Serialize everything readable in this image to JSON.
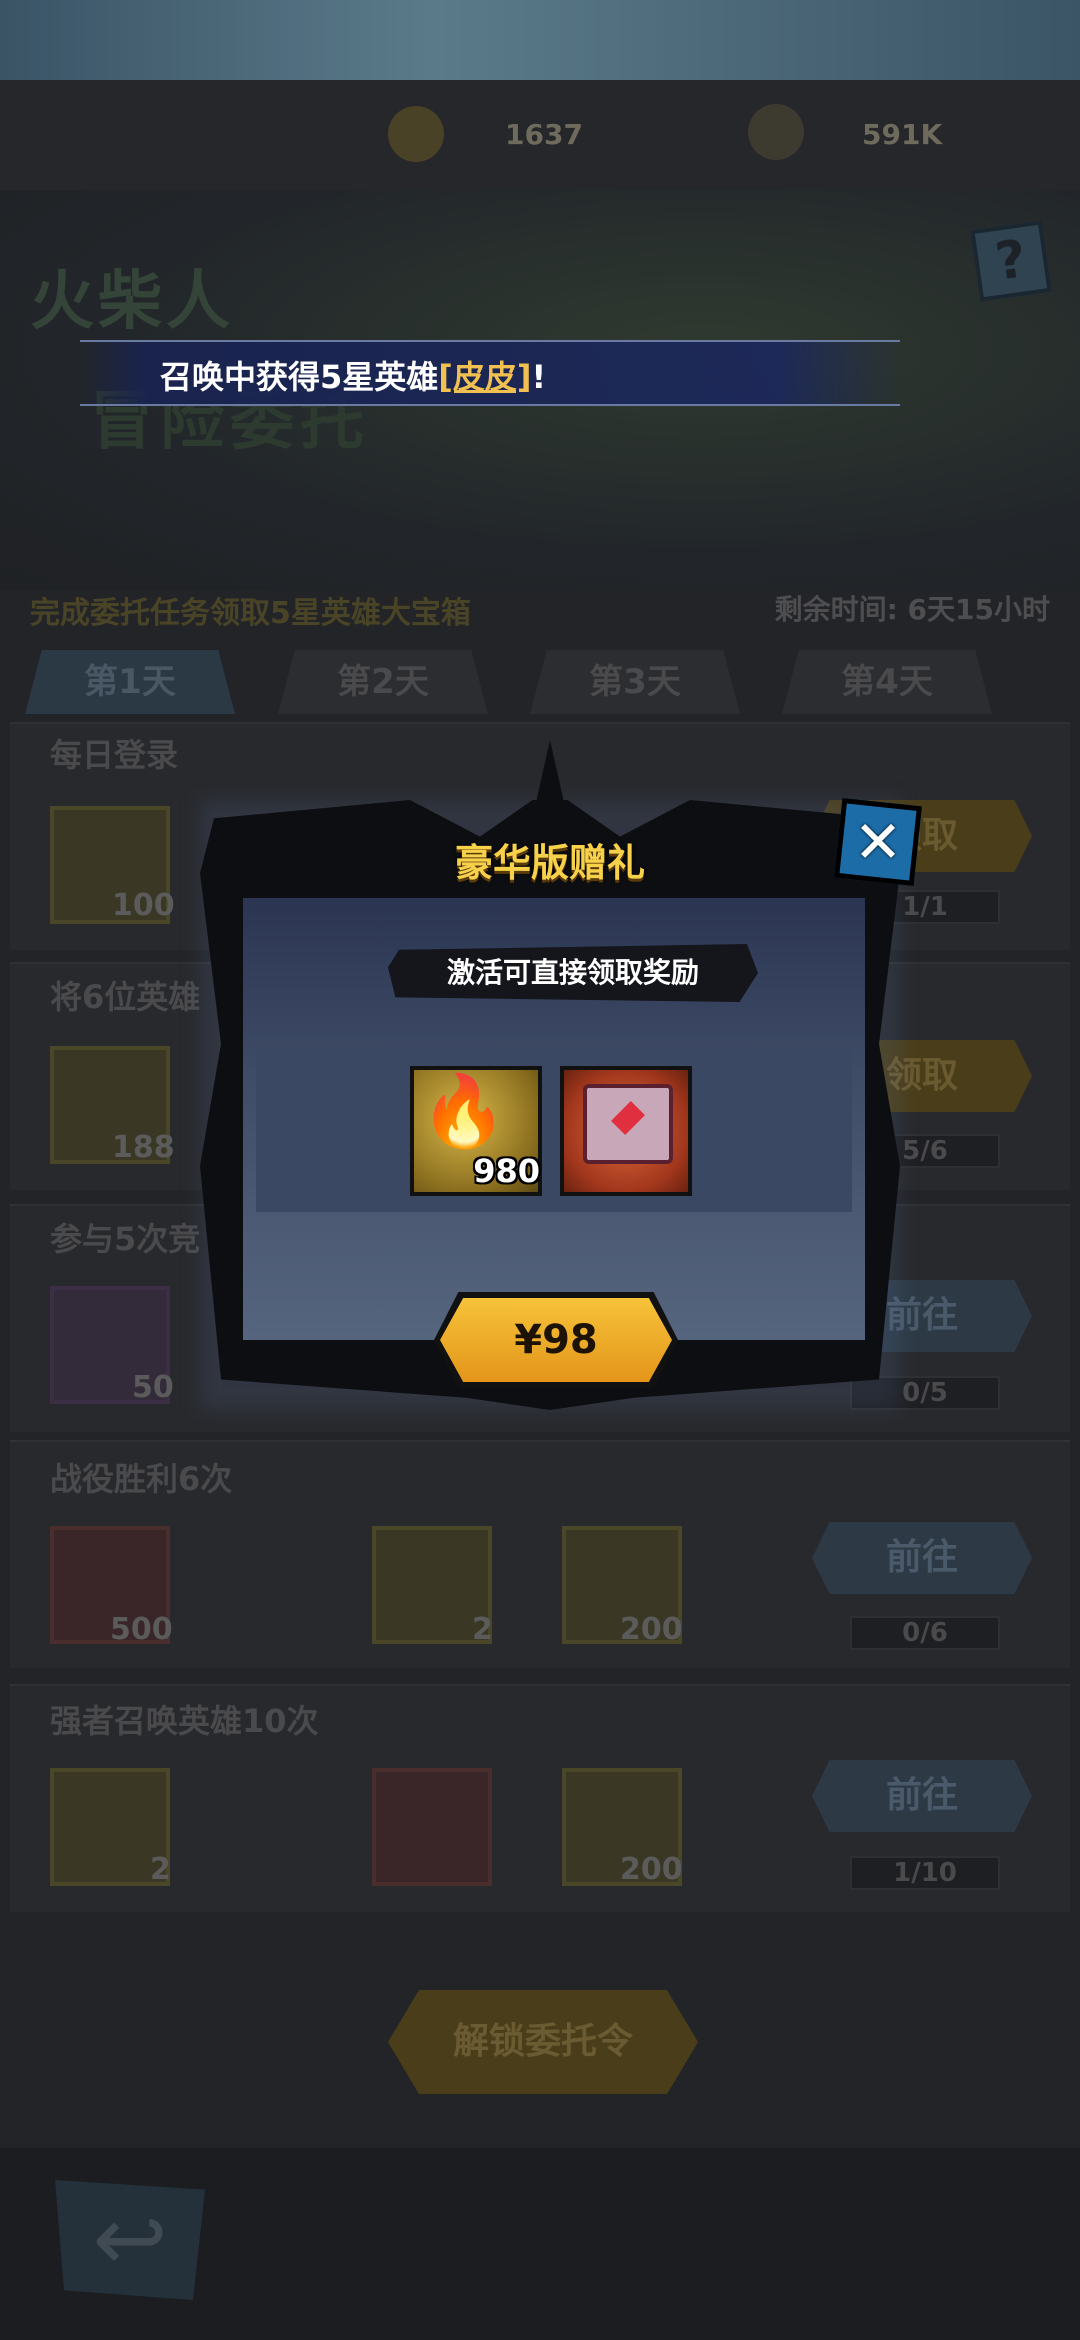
{
  "resources": {
    "torch_value": "1637",
    "coin_value": "591K"
  },
  "banner": {
    "title_line1": "火柴人",
    "title_line2": "冒险委托",
    "help_label": "?"
  },
  "notice": {
    "prefix": "召唤中获得5星英雄",
    "hero": "[皮皮]",
    "suffix": "!"
  },
  "event": {
    "subtitle": "完成委托任务领取5星英雄大宝箱",
    "remaining": "剩余时间: 6天15小时"
  },
  "tabs": [
    "第1天",
    "第2天",
    "第3天",
    "第4天"
  ],
  "tasks": [
    {
      "title": "每日登录",
      "reward_count": "100",
      "button": "领取",
      "progress": "1/1"
    },
    {
      "title": "将6位英雄",
      "reward_count": "188",
      "button": "领取",
      "progress": "5/6"
    },
    {
      "title": "参与5次竞",
      "reward_count": "50",
      "button": "前往",
      "progress": "0/5"
    },
    {
      "title": "战役胜利6次",
      "reward_counts": [
        "500",
        "2",
        "200"
      ],
      "button": "前往",
      "progress": "0/6"
    },
    {
      "title": "强者召唤英雄10次",
      "reward_counts": [
        "2",
        "200"
      ],
      "button": "前往",
      "progress": "1/10"
    }
  ],
  "unlock_button": "解锁委托令",
  "modal": {
    "title": "豪华版赠礼",
    "description": "激活可直接领取奖励",
    "rewards": [
      {
        "icon": "torch-icon",
        "count": "980"
      },
      {
        "icon": "treasure-chest-icon",
        "count": ""
      }
    ],
    "price": "¥98",
    "close_label": "✕"
  },
  "colors": {
    "accent_gold": "#f7c33a",
    "close_blue": "#1c6ca8",
    "highlight": "#f0c050"
  }
}
